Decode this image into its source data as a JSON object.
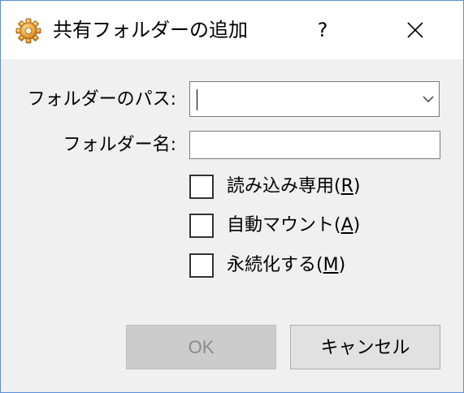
{
  "window": {
    "title": "共有フォルダーの追加",
    "help_label": "?"
  },
  "form": {
    "folder_path_label": "フォルダーのパス:",
    "folder_path_value": "",
    "folder_name_label": "フォルダー名:",
    "folder_name_value": ""
  },
  "options": [
    {
      "prefix": "読み込み専用(",
      "mnemonic": "R",
      "suffix": ")",
      "checked": false
    },
    {
      "prefix": "自動マウント(",
      "mnemonic": "A",
      "suffix": ")",
      "checked": false
    },
    {
      "prefix": "永続化する(",
      "mnemonic": "M",
      "suffix": ")",
      "checked": false
    }
  ],
  "buttons": {
    "ok_label": "OK",
    "ok_enabled": false,
    "cancel_label": "キャンセル"
  },
  "icons": {
    "window_icon": "gear-icon",
    "close": "close-icon",
    "combo_arrow": "chevron-down-icon"
  },
  "colors": {
    "border": "#5b8fd6",
    "dialog_bg": "#f0f0f0",
    "ok_disabled_bg": "#cccccc",
    "ok_disabled_text": "#8a8a8a"
  }
}
